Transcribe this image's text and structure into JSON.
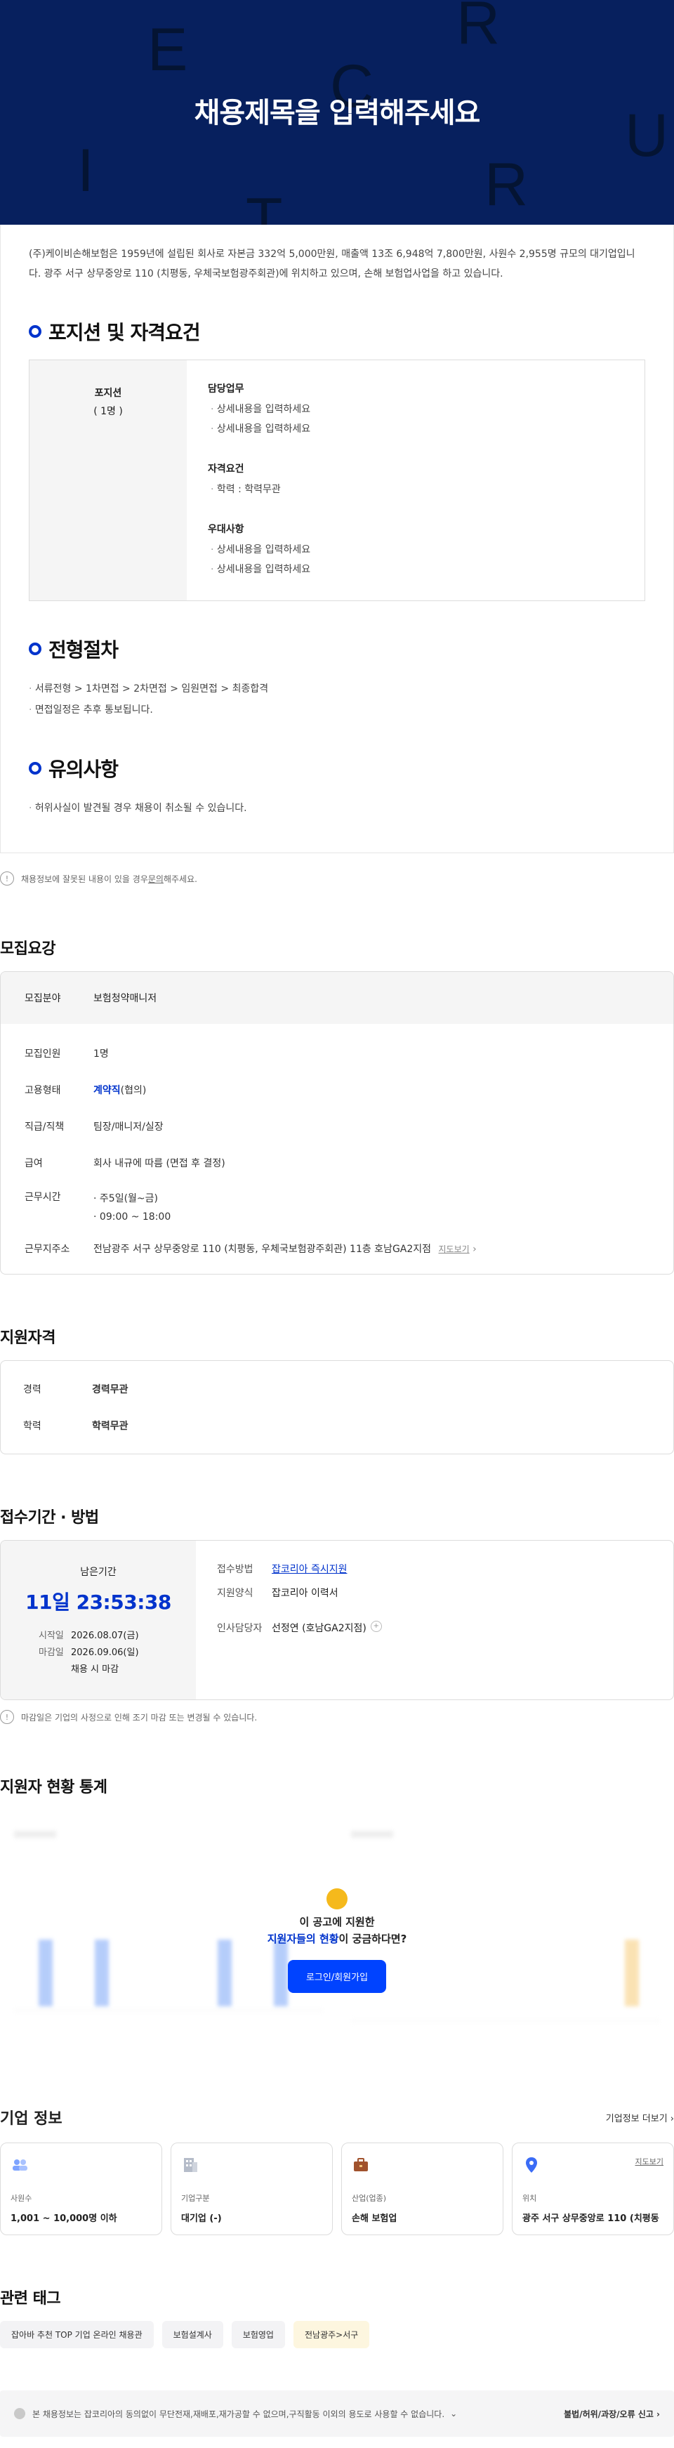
{
  "hero": {
    "title": "채용제목을 입력해주세요",
    "letters": [
      "E",
      "R",
      "C",
      "I",
      "R",
      "U",
      "T"
    ]
  },
  "intro": "(주)케이비손해보험은 1959년에 설립된 회사로 자본금 332억 5,000만원, 매출액 13조 6,948억 7,800만원, 사원수 2,955명 규모의 대기업입니다. 광주 서구 상무중앙로 110 (치평동, 우체국보험광주회관)에 위치하고 있으며, 손해 보험업사업을 하고 있습니다.",
  "position_section": {
    "title": "포지션 및 자격요건",
    "position_label": "포지션",
    "position_count": "( 1명 )",
    "groups": [
      {
        "title": "담당업무",
        "items": [
          "상세내용을 입력하세요",
          "상세내용을 입력하세요"
        ]
      },
      {
        "title": "자격요건",
        "items": [
          "학력 : 학력무관"
        ]
      },
      {
        "title": "우대사항",
        "items": [
          "상세내용을 입력하세요",
          "상세내용을 입력하세요"
        ]
      }
    ]
  },
  "process_section": {
    "title": "전형절차",
    "items": [
      "서류전형 > 1차면접 > 2차면접 > 임원면접 > 최종합격",
      "면접일정은 추후 통보됩니다."
    ]
  },
  "notice_section": {
    "title": "유의사항",
    "items": [
      "허위사실이 발견될 경우 채용이 취소될 수 있습니다."
    ]
  },
  "report_note": {
    "prefix": "채용정보에 잘못된 내용이 있을 경우 ",
    "link": "문의",
    "suffix": "해주세요."
  },
  "recruit": {
    "title": "모집요강",
    "field_label": "모집분야",
    "field_value": "보험청약매니저",
    "rows": [
      {
        "k": "모집인원",
        "v": "1명"
      },
      {
        "k": "고용형태",
        "v": "계약직",
        "v2": "(협의)"
      },
      {
        "k": "직급/직책",
        "v": "팀장/매니저/실장"
      },
      {
        "k": "급여",
        "v": "회사 내규에 따름 (면접 후 결정)"
      },
      {
        "k": "근무시간",
        "v": "주5일(월~금)",
        "v2": "09:00 ~ 18:00"
      },
      {
        "k": "근무지주소",
        "v": "전남광주 서구 상무중앙로 110 (치평동, 우체국보험광주회관) 11층 호남GA2지점",
        "link": "지도보기"
      }
    ]
  },
  "qualification": {
    "title": "지원자격",
    "rows": [
      {
        "k": "경력",
        "v": "경력무관"
      },
      {
        "k": "학력",
        "v": "학력무관"
      }
    ]
  },
  "apply": {
    "title": "접수기간 · 방법",
    "remain_label": "남은기간",
    "countdown": "11일 23:53:38",
    "start_label": "시작일",
    "start": "2026.08.07(금)",
    "end_label": "마감일",
    "end": "2026.09.06(일)",
    "end_note": "채용 시 마감",
    "method_label": "접수방법",
    "method": "잡코리아 즉시지원",
    "form_label": "지원양식",
    "form": "잡코리아 이력서",
    "manager_label": "인사담당자",
    "manager": "선정연 (호남GA2지점)",
    "note": "마감일은 기업의 사정으로 인해 조기 마감 또는 변경될 수 있습니다."
  },
  "stats": {
    "title": "지원자 현황 통계",
    "question_line1": "이 공고에 지원한",
    "question_hl": "지원자들의 현황",
    "question_line2": "이 궁금하다면?",
    "button": "로그인/회원가입"
  },
  "company": {
    "title": "기업 정보",
    "more": "기업정보 더보기",
    "cards": [
      {
        "icon": "people-icon",
        "label": "사원수",
        "value": "1,001 ~ 10,000명 이하"
      },
      {
        "icon": "building-icon",
        "label": "기업구분",
        "value": "대기업 (-)"
      },
      {
        "icon": "briefcase-icon",
        "label": "산업(업종)",
        "value": "손해 보험업"
      },
      {
        "icon": "map-pin-icon",
        "label": "위치",
        "value": "광주 서구 상무중앙로 110 (치평동",
        "link": "지도보기"
      }
    ]
  },
  "tags": {
    "title": "관련 태그",
    "items": [
      "잡아바 추천 TOP 기업 온라인 채용관",
      "보험설계사",
      "보험영업",
      "전남광주>서구"
    ]
  },
  "footer": {
    "text": "본 채용정보는 잡코리아의 동의없이 무단전재,재배포,재가공할 수 없으며,구직활동 이외의 용도로 사용할 수 없습니다.",
    "report": "불법/허위/과장/오류 신고"
  },
  "colors": {
    "accent": "#0033cc",
    "hero_bg": "#07205e",
    "button": "#0043ff"
  }
}
